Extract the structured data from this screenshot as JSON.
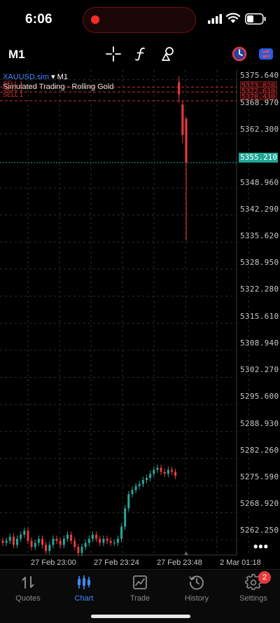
{
  "status_bar": {
    "time": "6:06"
  },
  "toolbar": {
    "timeframe": "M1",
    "icons": [
      "crosshair-icon",
      "function-icon",
      "objects-icon",
      "clock-icon",
      "switch-icon"
    ]
  },
  "chart": {
    "symbol": "XAUUSD.sim",
    "timeframe": "M1",
    "subtitle": "Simulated Trading - Rolling Gold",
    "current_price": "5355.210",
    "sell_tags": [
      "SELL 1",
      "SELL 1",
      "SELL 1"
    ],
    "order_prices": [
      "5373.820",
      "5372.610",
      "5370.430",
      "5368.970"
    ],
    "price_ticks": [
      "5375.640",
      "5362.300",
      "5348.960",
      "5342.290",
      "5335.620",
      "5328.950",
      "5322.280",
      "5315.610",
      "5308.940",
      "5302.270",
      "5295.600",
      "5288.930",
      "5282.260",
      "5275.590",
      "5268.920",
      "5262.250"
    ],
    "time_ticks": [
      "27 Feb 23:00",
      "27 Feb 23:24",
      "27 Feb 23:48",
      "2 Mar 01:18"
    ],
    "more": "•••"
  },
  "chart_data": {
    "type": "candlestick",
    "symbol": "XAUUSD.sim",
    "timeframe": "M1",
    "ylim": [
      5258.5,
      5378.0
    ],
    "x": [
      "27 Feb 23:00",
      "27 Feb 23:24",
      "27 Feb 23:48",
      "2 Mar 01:18"
    ],
    "y": [
      5261.5,
      5262.0,
      5263.0,
      5261.0,
      5262.5,
      5263.5,
      5264.5,
      5262.0,
      5260.5,
      5261.5,
      5262.5,
      5261.0,
      5259.5,
      5261.0,
      5262.5,
      5262.0,
      5261.0,
      5262.5,
      5263.5,
      5262.0,
      5260.5,
      5259.0,
      5260.5,
      5261.5,
      5262.5,
      5263.5,
      5262.5,
      5261.5,
      5262.5,
      5262.0,
      5261.5,
      5261.5,
      5262.5,
      5265.5,
      5270.0,
      5273.5,
      5274.5,
      5275.5,
      5276.0,
      5277.0,
      5277.5,
      5278.5,
      5279.5,
      5280.0,
      5279.0,
      5278.5,
      5279.5,
      5279.0,
      5278.0,
      5372.0,
      5362.0,
      5355.21
    ],
    "current_price": 5355.21
  },
  "nav": {
    "items": [
      {
        "label": "Quotes",
        "icon": "quotes-icon"
      },
      {
        "label": "Chart",
        "icon": "chart-icon"
      },
      {
        "label": "Trade",
        "icon": "trade-icon"
      },
      {
        "label": "History",
        "icon": "history-icon"
      },
      {
        "label": "Settings",
        "icon": "settings-icon"
      }
    ],
    "active": "Chart",
    "settings_badge": "2"
  },
  "colors": {
    "accent": "#3b8cff",
    "bull": "#26a69a",
    "bear": "#ef3b3b",
    "current_line": "#1fa898",
    "order_line": "#c83030"
  }
}
